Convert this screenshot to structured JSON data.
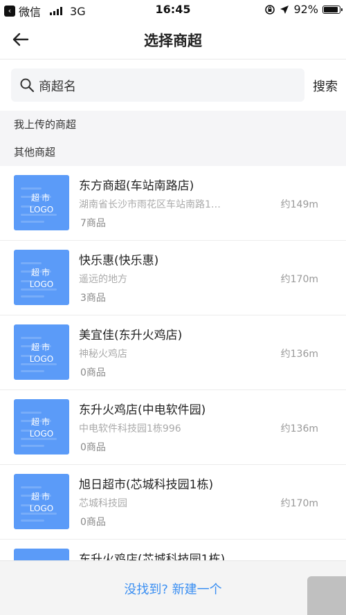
{
  "status_bar": {
    "back_app_icon": "back-box-icon",
    "carrier": "微信",
    "network": "3G",
    "time": "16:45",
    "battery_text": "92%",
    "battery_level": 0.92
  },
  "nav": {
    "back_icon": "arrow-left-icon",
    "title": "选择商超"
  },
  "search": {
    "icon": "search-icon",
    "placeholder": "商超名",
    "button_label": "搜索"
  },
  "sections": {
    "mine": "我上传的商超",
    "others": "其他商超"
  },
  "logo": {
    "line1": "超市",
    "line2": "LOGO",
    "color": "#5b9bf8"
  },
  "stores": [
    {
      "name": "东方商超(车站南路店)",
      "address": "湖南省长沙市雨花区车站南路1…",
      "count": "7商品",
      "distance": "约149m"
    },
    {
      "name": "快乐惠(快乐惠)",
      "address": "遥远的地方",
      "count": "3商品",
      "distance": "约170m"
    },
    {
      "name": "美宜佳(东升火鸡店)",
      "address": "神秘火鸡店",
      "count": "0商品",
      "distance": "约136m"
    },
    {
      "name": "东升火鸡店(中电软件园)",
      "address": "中电软件科技园1栋996",
      "count": "0商品",
      "distance": "约136m"
    },
    {
      "name": "旭日超市(芯城科技园1栋)",
      "address": "芯城科技园",
      "count": "0商品",
      "distance": "约170m"
    },
    {
      "name": "东升火鸡店(芯城科技园1栋)",
      "address": "",
      "count": "",
      "distance": ""
    }
  ],
  "bottom": {
    "link": "没找到? 新建一个"
  },
  "colors": {
    "accent": "#3b8ff2",
    "section_bg": "#f5f5f7"
  }
}
